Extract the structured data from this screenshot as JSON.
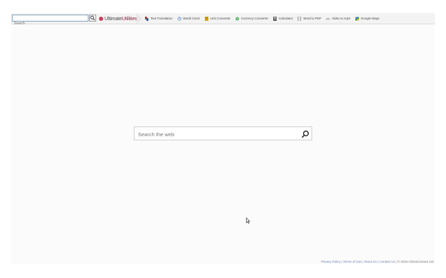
{
  "toolbar": {
    "search_placeholder": "Search",
    "search_button": "search-icon",
    "logo": {
      "part1": "Ultimate",
      "part2": "Utilities"
    },
    "links": [
      {
        "label": "Text Translation",
        "icon": "translate-icon",
        "color": "#c0392b"
      },
      {
        "label": "World Clock",
        "icon": "clock-icon",
        "color": "#2d5fa6"
      },
      {
        "label": "Unit Converter",
        "icon": "ruler-icon",
        "color": "#d9a400"
      },
      {
        "label": "Currency Converter",
        "icon": "currency-icon",
        "color": "#2e9e46"
      },
      {
        "label": "Calculator",
        "icon": "calculator-icon",
        "color": "#555555"
      },
      {
        "label": "Word to PDF",
        "icon": "document-icon",
        "color": "#666666"
      },
      {
        "label": "Video to mp3",
        "icon": "video-icon",
        "color": "#777777"
      },
      {
        "label": "Google Maps",
        "icon": "map-icon",
        "color": "#3a8f3a"
      }
    ]
  },
  "main": {
    "search_placeholder": "Search the web",
    "search_button": "search-icon"
  },
  "footer": {
    "links": [
      "Privacy Policy",
      "Terms of Use",
      "About Us",
      "Contact Us"
    ],
    "copyright": "© 2015 ClientConnect Ltd"
  }
}
